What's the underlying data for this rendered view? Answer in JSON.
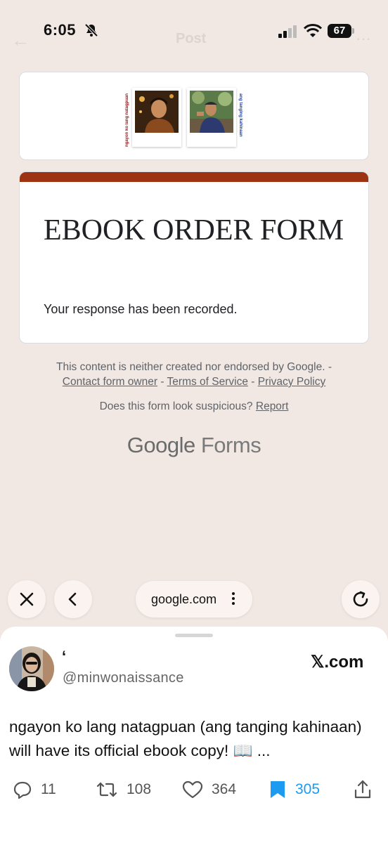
{
  "status_bar": {
    "time": "6:05",
    "battery": "67",
    "icons": [
      "bell-slash-icon",
      "signal-icon",
      "wifi-icon",
      "battery-icon"
    ]
  },
  "background_header": {
    "title": "Post"
  },
  "banner": {
    "left_caption": "ngayon ko lang natagpuan",
    "right_caption": "ang tanging kahinaan"
  },
  "form": {
    "title": "EBOOK ORDER FORM",
    "message": "Your response has been recorded.",
    "accent_color": "#9c3413"
  },
  "footer": {
    "disclaimer": "This content is neither created nor endorsed by Google. -",
    "contact_link": "Contact form owner",
    "separator": " - ",
    "terms_link": "Terms of Service",
    "privacy_link": "Privacy Policy",
    "suspicious_text": "Does this form look suspicious?",
    "report_link": "Report",
    "brand_google": "Google",
    "brand_forms": "Forms"
  },
  "browser": {
    "url": "google.com",
    "icons": [
      "close-icon",
      "back-icon",
      "more-vertical-icon",
      "reload-icon"
    ]
  },
  "tweet": {
    "display_name": "‘",
    "handle": "@minwonaissance",
    "source": "𝕏.com",
    "text": "ngayon ko lang natagpuan (ang tanging kahinaan) will have its official ebook copy! 📖 ...",
    "replies": "11",
    "retweets": "108",
    "likes": "364",
    "bookmarks": "305",
    "bookmark_color": "#1d9bf0"
  }
}
